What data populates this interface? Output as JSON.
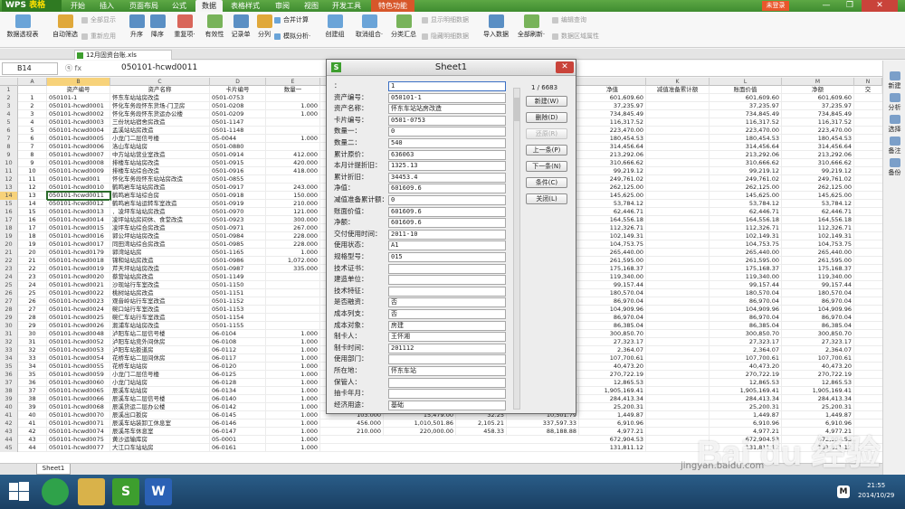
{
  "app": {
    "logo_a": "WPS",
    "logo_b": "表格",
    "login": "未登录",
    "window_controls": [
      "—",
      "❐",
      "✕"
    ]
  },
  "menu_tabs": [
    "开始",
    "插入",
    "页面布局",
    "公式",
    "数据",
    "表格样式",
    "审阅",
    "视图",
    "开发工具",
    "特色功能"
  ],
  "active_menu": "数据",
  "ribbon": {
    "big": [
      {
        "label": "数据透视表",
        "icon": "pivot-table-icon"
      },
      {
        "label": "自动筛选",
        "icon": "filter-icon"
      },
      {
        "label": "升序",
        "icon": "sort-asc-icon"
      },
      {
        "label": "降序",
        "icon": "sort-desc-icon"
      },
      {
        "label": "重复项·",
        "icon": "duplicate-icon"
      },
      {
        "label": "有效性",
        "icon": "validation-icon"
      },
      {
        "label": "记录单",
        "icon": "record-form-icon"
      },
      {
        "label": "分列",
        "icon": "split-column-icon"
      },
      {
        "label": "创建组",
        "icon": "group-icon"
      },
      {
        "label": "取消组合·",
        "icon": "ungroup-icon"
      },
      {
        "label": "分类汇总",
        "icon": "subtotal-icon"
      },
      {
        "label": "导入数据",
        "icon": "import-icon"
      },
      {
        "label": "全部刷新·",
        "icon": "refresh-icon"
      }
    ],
    "small": [
      "全部显示",
      "重新应用",
      "合并计算",
      "模拟分析·",
      "显示明细数据",
      "隐藏明细数据",
      "编辑查询",
      "数据区域属性"
    ]
  },
  "doc_tab": "12月固资台账.xls",
  "formula_bar": {
    "cell": "B14",
    "fx_icons": "ⓠ   fx",
    "value": "050101-hcwd0011"
  },
  "columns": [
    "",
    "A",
    "B",
    "C",
    "D",
    "E",
    "",
    "",
    "",
    "",
    "K",
    "L",
    "M",
    "N"
  ],
  "header_row": {
    "num": "1",
    "A": "",
    "B": "资产编号",
    "C": "资产名称",
    "D": "卡片编号",
    "E": "数量一",
    "J": "净值",
    "K": "减值准备累计额",
    "L": "账面价值",
    "M": "净额",
    "N": "交"
  },
  "rows": [
    [
      "2",
      "1",
      "050101-1",
      "怀东车站站房改造",
      "0501-0753",
      "",
      "601,609.60",
      "",
      "601,609.60",
      "601,609.60"
    ],
    [
      "3",
      "2",
      "050101-hcwd0001",
      "怀化车务段怀东货场-门卫房",
      "0501-0208",
      "1.000",
      "37,235.97",
      "",
      "37,235.97",
      "37,235.97"
    ],
    [
      "4",
      "3",
      "050101-hcwd0002",
      "怀化车务段怀东货运办公楼",
      "0501-0209",
      "1.000",
      "734,845.49",
      "",
      "734,845.49",
      "734,845.49"
    ],
    [
      "5",
      "4",
      "050101-hcwd0003",
      "三份坑站宿舍房改造",
      "0501-1147",
      "",
      "116,317.52",
      "",
      "116,317.52",
      "116,317.52"
    ],
    [
      "6",
      "5",
      "050101-hcwd0004",
      "孟溪站站房改造",
      "0501-1148",
      "",
      "223,470.00",
      "",
      "223,470.00",
      "223,470.00"
    ],
    [
      "7",
      "6",
      "050101-hcwd0005",
      "小龙门二层信号楼",
      "05-0044",
      "1.000",
      "180,454.53",
      "",
      "180,454.53",
      "180,454.53"
    ],
    [
      "8",
      "7",
      "050101-hcwd0006",
      "洛山车站站房",
      "0501-0880",
      "",
      "314,456.64",
      "",
      "314,456.64",
      "314,456.64"
    ],
    [
      "9",
      "8",
      "050101-hcwd0007",
      "中方站站营业室改造",
      "0501-0914",
      "412.000",
      "213,292.06",
      "",
      "213,292.06",
      "213,292.06"
    ],
    [
      "10",
      "9",
      "050101-hcwd0008",
      "排楼车站站房改造",
      "0501-0915",
      "420.000",
      "310,666.62",
      "",
      "310,666.62",
      "310,666.62"
    ],
    [
      "11",
      "10",
      "050101-hcwd0009",
      "排楼车站综合改造",
      "0501-0916",
      "418.000",
      "99,219.12",
      "",
      "99,219.12",
      "99,219.12"
    ],
    [
      "12",
      "11",
      "050101-hcwd001",
      "怀化车务段怀东站站房改造",
      "0501-0855",
      "",
      "249,761.02",
      "",
      "249,761.02",
      "249,761.02"
    ],
    [
      "13",
      "12",
      "050101-hcwd0010",
      "鹤鸣岩车站站房改造",
      "0501-0917",
      "243.000",
      "262,125.00",
      "",
      "262,125.00",
      "262,125.00"
    ],
    [
      "14",
      "13",
      "050101-hcwd0011",
      "鹤鸣岩车站综合房",
      "0501-0918",
      "150.000",
      "145,625.00",
      "",
      "145,625.00",
      "145,625.00"
    ],
    [
      "15",
      "14",
      "050101-hcwd0012",
      "鹤鸣岩车站运转车室改造",
      "0501-0919",
      "210.000",
      "53,784.12",
      "",
      "53,784.12",
      "53,784.12"
    ],
    [
      "16",
      "15",
      "050101-hcwd0013",
      "．凌坪车站站房改造",
      "0501-0970",
      "121.000",
      "62,446.71",
      "",
      "62,446.71",
      "62,446.71"
    ],
    [
      "17",
      "16",
      "050101-hcwd0014",
      "凌坪站站房间休、食堂改造",
      "0501-0923",
      "300.000",
      "164,556.18",
      "",
      "164,556.18",
      "164,556.18"
    ],
    [
      "18",
      "17",
      "050101-hcwd0015",
      "凌坪车站综合房改造",
      "0501-0971",
      "267.000",
      "112,326.71",
      "",
      "112,326.71",
      "112,326.71"
    ],
    [
      "19",
      "18",
      "050101-hcwd0016",
      "郭公坪站站房改造",
      "0501-0984",
      "228.000",
      "102,149.31",
      "",
      "102,149.31",
      "102,149.31"
    ],
    [
      "20",
      "19",
      "050101-hcwd0017",
      "同田湾站综合房改造",
      "0501-0985",
      "228.000",
      "104,753.75",
      "",
      "104,753.75",
      "104,753.75"
    ],
    [
      "21",
      "20",
      "050101-hcwd0179",
      "郭湾站站房",
      "0501-1165",
      "1.000",
      "265,440.00",
      "",
      "265,440.00",
      "265,440.00"
    ],
    [
      "22",
      "21",
      "050101-hcwd0018",
      "锦和站站房改造",
      "0501-0986",
      "1,072.000",
      "261,595.00",
      "",
      "261,595.00",
      "261,595.00"
    ],
    [
      "23",
      "22",
      "050101-hcwd0019",
      "芹天坪站站房改造",
      "0501-0987",
      "335.000",
      "175,168.37",
      "",
      "175,168.37",
      "175,168.37"
    ],
    [
      "24",
      "23",
      "050101-hcwd0020",
      "蔡营站站房改造",
      "0501-1149",
      "",
      "119,340.00",
      "",
      "119,340.00",
      "119,340.00"
    ],
    [
      "25",
      "24",
      "050101-hcwd0021",
      "沙现站行车室改造",
      "0501-1150",
      "",
      "99,157.44",
      "",
      "99,157.44",
      "99,157.44"
    ],
    [
      "26",
      "25",
      "050101-hcwd0022",
      "桃树站站房改造",
      "0501-1151",
      "",
      "180,570.04",
      "",
      "180,570.04",
      "180,570.04"
    ],
    [
      "27",
      "26",
      "050101-hcwd0023",
      "观音岭站行车室改造",
      "0501-1152",
      "",
      "86,970.04",
      "",
      "86,970.04",
      "86,970.04"
    ],
    [
      "28",
      "27",
      "050101-hcwd0024",
      "碗口站行车室改造",
      "0501-1153",
      "",
      "104,909.96",
      "",
      "104,909.96",
      "104,909.96"
    ],
    [
      "29",
      "28",
      "050101-hcwd0025",
      "碗仁车站行车室改造",
      "0501-1154",
      "",
      "86,970.04",
      "",
      "86,970.04",
      "86,970.04"
    ],
    [
      "30",
      "29",
      "050101-hcwd0026",
      "溆浦车站站房改造",
      "0501-1155",
      "",
      "86,385.04",
      "",
      "86,385.04",
      "86,385.04"
    ],
    [
      "31",
      "30",
      "050101-hcwd0048",
      "泸阳车站二层信号楼",
      "06-0104",
      "1.000",
      "300,850.70",
      "",
      "300,850.70",
      "300,850.70"
    ],
    [
      "32",
      "31",
      "050101-hcwd0052",
      "泸阳车站竞外间休房",
      "06-0108",
      "1.000",
      "27,323.17",
      "",
      "27,323.17",
      "27,323.17"
    ],
    [
      "33",
      "32",
      "050101-hcwd0053",
      "泸阳车站扳道房",
      "06-0112",
      "1.000",
      "2,364.07",
      "",
      "2,364.07",
      "2,364.07"
    ],
    [
      "34",
      "33",
      "050101-hcwd0054",
      "花桥车站二层间休房",
      "06-0117",
      "1.000",
      "107,700.61",
      "",
      "107,700.61",
      "107,700.61"
    ],
    [
      "35",
      "34",
      "050101-hcwd0055",
      "花桥车站站房",
      "06-0120",
      "1.000",
      "40,473.20",
      "",
      "40,473.20",
      "40,473.20"
    ],
    [
      "36",
      "35",
      "050101-hcwd0059",
      "小龙门二层信号楼",
      "06-0125",
      "1.000",
      "270,722.19",
      "",
      "270,722.19",
      "270,722.19"
    ],
    [
      "37",
      "36",
      "050101-hcwd0060",
      "小龙门站站房",
      "06-0128",
      "1.000",
      "12,865.53",
      "",
      "12,865.53",
      "12,865.53"
    ],
    [
      "38",
      "37",
      "050101-hcwd0065",
      "辰溪车站站房",
      "06-0134",
      "1.000",
      "1,905,169.41",
      "",
      "1,905,169.41",
      "1,905,169.41"
    ],
    [
      "39",
      "38",
      "050101-hcwd0066",
      "辰溪车站二层信号楼",
      "06-0140",
      "1.000",
      "284,413.34",
      "",
      "284,413.34",
      "284,413.34"
    ],
    [
      "40",
      "39",
      "050101-hcwd0068",
      "辰溪货运二层办公楼",
      "06-0142",
      "1.000",
      "25,200.31",
      "",
      "25,200.31",
      "25,200.31"
    ],
    [
      "41",
      "40",
      "050101-hcwd0070",
      "辰溪出口扳房",
      "06-0145",
      "1.000",
      "1,449.87",
      "",
      "1,449.87",
      "1,449.87"
    ],
    [
      "42",
      "41",
      "050101-hcwd0071",
      "辰溪车站装卸工休息室",
      "06-0146",
      "1.000",
      "6,910.96",
      "",
      "6,910.96",
      "6,910.96"
    ],
    [
      "43",
      "42",
      "050101-hcwd0074",
      "辰溪吊车休息室",
      "06-0147",
      "1.000",
      "4,977.21",
      "",
      "4,977.21",
      "4,977.21"
    ],
    [
      "44",
      "43",
      "050101-hcwd0075",
      "黄沙运输库房",
      "05-0001",
      "1.000",
      "672,904.53",
      "",
      "672,904.53",
      "672,904.53"
    ],
    [
      "45",
      "44",
      "050101-hcwd0077",
      "大江口车站站房",
      "06-0161",
      "1.000",
      "131,811.12",
      "",
      "131,811.12",
      "131,811.12"
    ]
  ],
  "hidden_cols_rows": [
    {
      "row": "38",
      "a": "204.000",
      "b": "78,377.00",
      "c": "163.29",
      "d": "53,176.69"
    },
    {
      "row": "39",
      "a": "8.000",
      "b": "4,995.00",
      "c": "10.41",
      "d": "3,545.13"
    },
    {
      "row": "40",
      "a": "154.000",
      "b": "28,031.00",
      "c": "58.40",
      "d": "21,120.04"
    },
    {
      "row": "41",
      "a": "103.000",
      "b": "15,479.00",
      "c": "32.25",
      "d": "10,501.79"
    },
    {
      "row": "42",
      "a": "456.000",
      "b": "1,010,501.86",
      "c": "2,105.21",
      "d": "337,597.33"
    },
    {
      "row": "43",
      "a": "210.000",
      "b": "220,000.00",
      "c": "458.33",
      "d": "88,188.88"
    }
  ],
  "sheet_tab": "Sheet1",
  "dialog": {
    "title": "Sheet1",
    "record": "1 / 6683",
    "fields": [
      {
        "label": "：",
        "value": "1"
      },
      {
        "label": "资产编号：",
        "value": "050101-1"
      },
      {
        "label": "资产名称：",
        "value": "怀东车站站房改造"
      },
      {
        "label": "卡片编号：",
        "value": "0501-0753"
      },
      {
        "label": "数量一：",
        "value": "0"
      },
      {
        "label": "数量二：",
        "value": "540"
      },
      {
        "label": "累计原价：",
        "value": "636063"
      },
      {
        "label": "本月计提折旧：",
        "value": "1325.13"
      },
      {
        "label": "累计折旧：",
        "value": "34453.4"
      },
      {
        "label": "净值：",
        "value": "601609.6"
      },
      {
        "label": "减值准备累计额：",
        "value": "0"
      },
      {
        "label": "账面价值：",
        "value": "601609.6"
      },
      {
        "label": "净额：",
        "value": "601609.6"
      },
      {
        "label": "交付使用时间：",
        "value": "2011-10"
      },
      {
        "label": "使用状态：",
        "value": "A1"
      },
      {
        "label": "规格型号：",
        "value": "015"
      },
      {
        "label": "技术证书：",
        "value": ""
      },
      {
        "label": "建造单位：",
        "value": ""
      },
      {
        "label": "技术特征：",
        "value": ""
      },
      {
        "label": "是否融资：",
        "value": "否"
      },
      {
        "label": "成本列支：",
        "value": "否"
      },
      {
        "label": "成本对象：",
        "value": "房建"
      },
      {
        "label": "制卡人：",
        "value": "王怀湘"
      },
      {
        "label": "制卡时间：",
        "value": "201112"
      },
      {
        "label": "使用部门：",
        "value": ""
      },
      {
        "label": "所在地：",
        "value": "怀东车站"
      },
      {
        "label": "保管人：",
        "value": ""
      },
      {
        "label": "抽卡年月：",
        "value": ""
      },
      {
        "label": "经济用途：",
        "value": "基础"
      }
    ],
    "buttons": [
      "新建(W)",
      "删除(D)",
      "还原(R)",
      "上一条(P)",
      "下一条(N)",
      "条件(C)",
      "关闭(L)"
    ]
  },
  "side_panel": [
    "新建",
    "分析",
    "选择",
    "备注",
    "备份"
  ],
  "taskbar": {
    "apps": [
      "",
      "S",
      "W"
    ],
    "time": "21:55",
    "date": "2014/10/29",
    "tray": "M"
  },
  "watermark": {
    "main": "Bai du 经验",
    "sub": "jingyan.baidu.com"
  },
  "colors": {
    "wps_green": "#3f8c30",
    "selection_gold": "#f7d27a",
    "selected_cell_border": "#2b6b2b",
    "close_red": "#c9433a"
  }
}
